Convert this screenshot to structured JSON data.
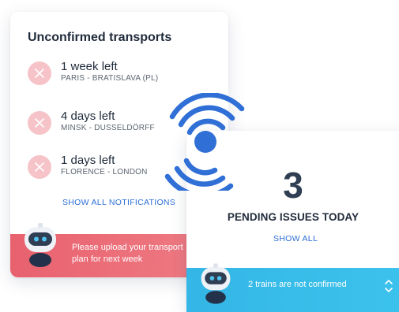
{
  "notifications_card": {
    "title": "Unconfirmed transports",
    "items": [
      {
        "time_left": "1 week left",
        "route": "PARIS - BRATISLAVA (PL)",
        "icon": "close-icon"
      },
      {
        "time_left": "4 days left",
        "route": "MINSK - DUSSELDÖRFF",
        "icon": "close-icon"
      },
      {
        "time_left": "1 days left",
        "route": "FLORENCE - LONDON",
        "icon": "close-icon"
      }
    ],
    "show_all_label": "SHOW ALL NOTIFICATIONS",
    "footer_message_line1": "Please upload your transport",
    "footer_message_line2": "plan for next week",
    "footer_color": "#e8616e"
  },
  "issues_card": {
    "count": "3",
    "label": "PENDING ISSUES TODAY",
    "show_all_label": "SHOW ALL",
    "footer_message": "2 trains are not confirmed",
    "footer_color": "#34b6e6"
  },
  "colors": {
    "accent_blue": "#2d6fd6",
    "alert_red": "#e8616e",
    "alert_icon_bg": "#f6c4c8",
    "info_cyan": "#34b6e6"
  },
  "icons": [
    "close-icon",
    "robot-avatar-icon",
    "signal-broadcast-icon",
    "chevron-up-down-icon"
  ]
}
